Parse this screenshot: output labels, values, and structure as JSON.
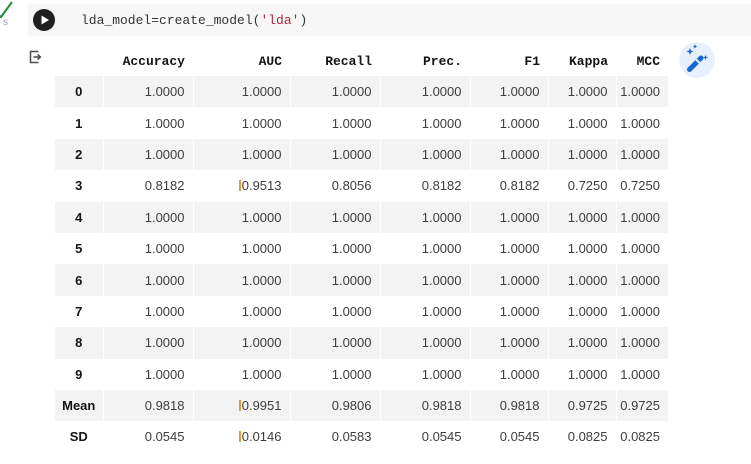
{
  "colors": {
    "accent-blue": "#1967d2",
    "wand-bg": "#e8f0fe",
    "code-bg": "#f7f7f7",
    "code-text": "#343434",
    "code-string": "#b3243c",
    "stripe": "#f3f3f3",
    "value-text": "#3d3d3d",
    "header-text": "#141414",
    "highlight-tick": "#e8973d",
    "success-green": "#1e8e3e",
    "play-bg": "#1f1f1f"
  },
  "cell": {
    "code_prefix": "lda_model=create_model(",
    "code_string": "'lda'",
    "code_suffix": ")",
    "exec_indicator": "s"
  },
  "output": {
    "table": {
      "index_header": "",
      "columns": [
        "Accuracy",
        "AUC",
        "Recall",
        "Prec.",
        "F1",
        "Kappa",
        "MCC"
      ],
      "rows": [
        {
          "label": "0",
          "values": [
            "1.0000",
            "1.0000",
            "1.0000",
            "1.0000",
            "1.0000",
            "1.0000",
            "1.0000"
          ]
        },
        {
          "label": "1",
          "values": [
            "1.0000",
            "1.0000",
            "1.0000",
            "1.0000",
            "1.0000",
            "1.0000",
            "1.0000"
          ]
        },
        {
          "label": "2",
          "values": [
            "1.0000",
            "1.0000",
            "1.0000",
            "1.0000",
            "1.0000",
            "1.0000",
            "1.0000"
          ]
        },
        {
          "label": "3",
          "values": [
            "0.8182",
            "0.9513",
            "0.8056",
            "0.8182",
            "0.8182",
            "0.7250",
            "0.7250"
          ],
          "auc_tick": true
        },
        {
          "label": "4",
          "values": [
            "1.0000",
            "1.0000",
            "1.0000",
            "1.0000",
            "1.0000",
            "1.0000",
            "1.0000"
          ]
        },
        {
          "label": "5",
          "values": [
            "1.0000",
            "1.0000",
            "1.0000",
            "1.0000",
            "1.0000",
            "1.0000",
            "1.0000"
          ]
        },
        {
          "label": "6",
          "values": [
            "1.0000",
            "1.0000",
            "1.0000",
            "1.0000",
            "1.0000",
            "1.0000",
            "1.0000"
          ]
        },
        {
          "label": "7",
          "values": [
            "1.0000",
            "1.0000",
            "1.0000",
            "1.0000",
            "1.0000",
            "1.0000",
            "1.0000"
          ]
        },
        {
          "label": "8",
          "values": [
            "1.0000",
            "1.0000",
            "1.0000",
            "1.0000",
            "1.0000",
            "1.0000",
            "1.0000"
          ]
        },
        {
          "label": "9",
          "values": [
            "1.0000",
            "1.0000",
            "1.0000",
            "1.0000",
            "1.0000",
            "1.0000",
            "1.0000"
          ]
        },
        {
          "label": "Mean",
          "values": [
            "0.9818",
            "0.9951",
            "0.9806",
            "0.9818",
            "0.9818",
            "0.9725",
            "0.9725"
          ],
          "auc_tick": true
        },
        {
          "label": "SD",
          "values": [
            "0.0545",
            "0.0146",
            "0.0583",
            "0.0545",
            "0.0545",
            "0.0825",
            "0.0825"
          ],
          "auc_tick": true
        }
      ]
    }
  }
}
